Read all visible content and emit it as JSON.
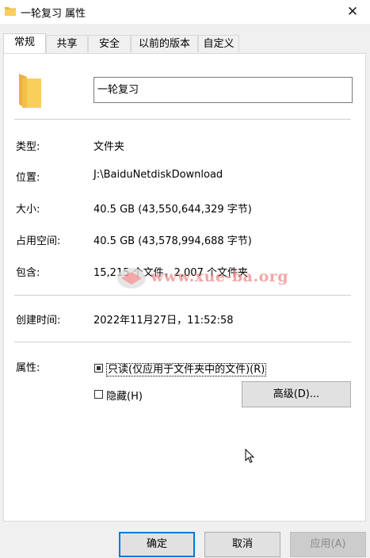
{
  "window": {
    "title": "一轮复习 属性",
    "close_glyph": "✕"
  },
  "tabs": [
    {
      "label": "常规",
      "active": true
    },
    {
      "label": "共享",
      "active": false
    },
    {
      "label": "安全",
      "active": false
    },
    {
      "label": "以前的版本",
      "active": false
    },
    {
      "label": "自定义",
      "active": false
    }
  ],
  "general": {
    "folder_name": "一轮复习",
    "type": {
      "label": "类型:",
      "value": "文件夹"
    },
    "location": {
      "label": "位置:",
      "value": "J:\\BaiduNetdiskDownload"
    },
    "size": {
      "label": "大小:",
      "value": "40.5 GB (43,550,644,329 字节)"
    },
    "disk_size": {
      "label": "占用空间:",
      "value": "40.5 GB (43,578,994,688 字节)"
    },
    "contains": {
      "label": "包含:",
      "value": "15,215 个文件，2,007 个文件夹"
    },
    "created": {
      "label": "创建时间:",
      "value": "2022年11月27日，11:52:58"
    },
    "attributes": {
      "label": "属性:",
      "readonly": {
        "label": "只读(仅应用于文件夹中的文件)(R)",
        "checked": true
      },
      "hidden": {
        "label": "隐藏(H)",
        "checked": false
      },
      "advanced_button": "高级(D)..."
    }
  },
  "watermark": {
    "text": "www.xue-ba.org"
  },
  "buttons": {
    "ok": "确定",
    "cancel": "取消",
    "apply": "应用(A)"
  },
  "colors": {
    "folder": "#f8cf5b",
    "folder_dark": "#e9b23a",
    "accent": "#0078d7"
  },
  "icons": {
    "folder": "folder-icon",
    "close": "close-icon",
    "cursor": "mouse-cursor-icon"
  }
}
